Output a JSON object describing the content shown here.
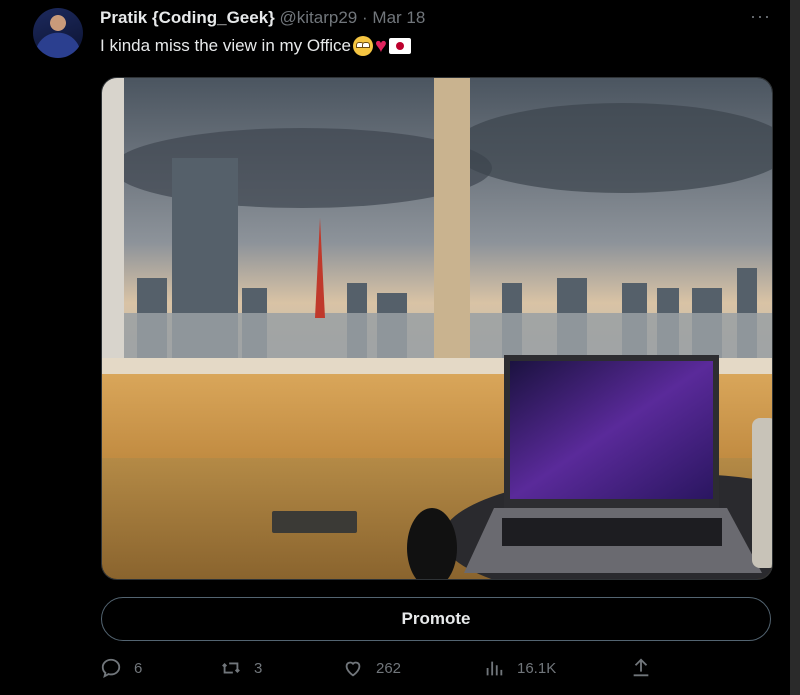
{
  "author": {
    "name": "Pratik {Coding_Geek}",
    "handle": "@kitarp29",
    "separator": "·",
    "date": "Mar 18"
  },
  "tweet": {
    "text": "I kinda miss the view in my Office",
    "emojis": [
      "face-with-rolling-eyes",
      "red-heart",
      "japan-flag"
    ]
  },
  "more_label": "···",
  "promote_label": "Promote",
  "actions": {
    "replies": "6",
    "reposts": "3",
    "likes": "262",
    "views": "16.1K"
  },
  "colors": {
    "background": "#000000",
    "muted": "#71767b",
    "text": "#e7e9ea",
    "border": "#536471"
  }
}
